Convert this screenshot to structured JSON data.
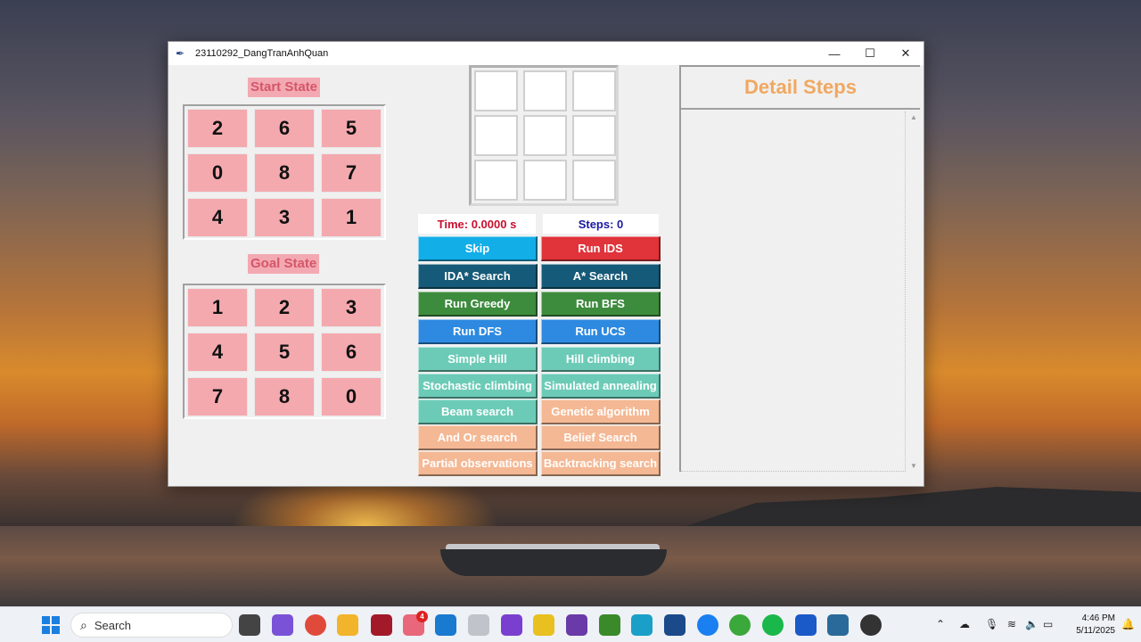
{
  "window": {
    "title": "23110292_DangTranAnhQuan",
    "minimize_glyph": "—",
    "maximize_glyph": "☐",
    "close_glyph": "✕"
  },
  "start_state": {
    "label": "Start State",
    "tiles": [
      "2",
      "6",
      "5",
      "0",
      "8",
      "7",
      "4",
      "3",
      "1"
    ]
  },
  "goal_state": {
    "label": "Goal State",
    "tiles": [
      "1",
      "2",
      "3",
      "4",
      "5",
      "6",
      "7",
      "8",
      "0"
    ]
  },
  "stats": {
    "time": "Time: 0.0000 s",
    "steps": "Steps: 0",
    "time_color": "#c8102e",
    "steps_color": "#1a1aa0"
  },
  "buttons": [
    {
      "label": "Skip",
      "color": "#12aee8"
    },
    {
      "label": "Run IDS",
      "color": "#e0333a"
    },
    {
      "label": "IDA* Search",
      "color": "#155a78"
    },
    {
      "label": "A* Search",
      "color": "#155a78"
    },
    {
      "label": "Run Greedy",
      "color": "#3d8b3d"
    },
    {
      "label": "Run BFS",
      "color": "#3d8b3d"
    },
    {
      "label": "Run DFS",
      "color": "#2e8ae0"
    },
    {
      "label": "Run UCS",
      "color": "#2e8ae0"
    },
    {
      "label": "Simple Hill",
      "color": "#6ccbb7"
    },
    {
      "label": "Hill climbing",
      "color": "#6ccbb7"
    },
    {
      "label": "Stochastic climbing",
      "color": "#6ccbb7"
    },
    {
      "label": "Simulated annealing",
      "color": "#6ccbb7"
    },
    {
      "label": "Beam search",
      "color": "#6ccbb7"
    },
    {
      "label": "Genetic algorithm",
      "color": "#f4b894"
    },
    {
      "label": "And Or search",
      "color": "#f4b894"
    },
    {
      "label": "Belief Search",
      "color": "#f4b894"
    },
    {
      "label": "Partial observations",
      "color": "#f4b894"
    },
    {
      "label": "Backtracking search",
      "color": "#f4b894"
    }
  ],
  "detail": {
    "title": "Detail Steps"
  },
  "taskbar": {
    "search_placeholder": "Search",
    "badge_count": "4",
    "time": "4:46 PM",
    "date": "5/11/2025"
  }
}
